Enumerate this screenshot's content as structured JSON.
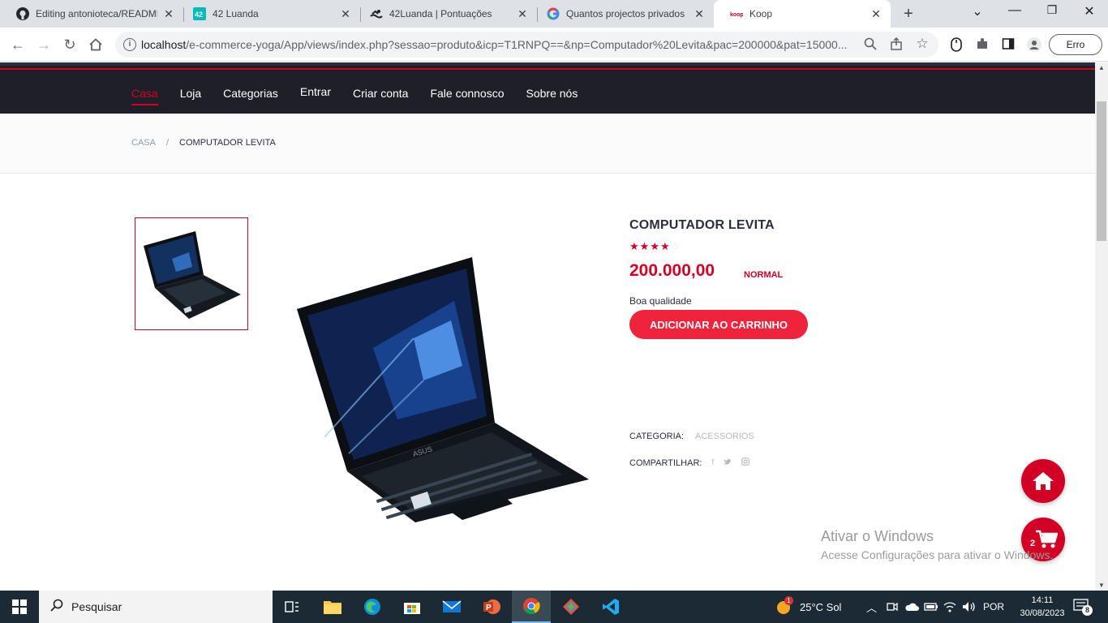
{
  "browser": {
    "tabs": [
      {
        "title": "Editing antonioteca/README.",
        "icon": "github-icon"
      },
      {
        "title": "42 Luanda",
        "icon": "42-icon"
      },
      {
        "title": "42Luanda | Pontuações",
        "icon": "swimmer-icon"
      },
      {
        "title": "Quantos projectos privados",
        "icon": "google-icon"
      },
      {
        "title": "Koop",
        "icon": "koop-icon",
        "active": true
      }
    ],
    "url_host": "localhost",
    "url_path": "/e-commerce-yoga/App/views/index.php?sessao=produto&icp=T1RNPQ==&np=Computador%20Levita&pac=200000&pat=15000...",
    "profile_button": "Erro",
    "newtab_glyph": "+",
    "close_glyph": "✕"
  },
  "site": {
    "nav": [
      "Casa",
      "Loja",
      "Categorias",
      "Entrar",
      "Criar conta",
      "Fale connosco",
      "Sobre nós"
    ],
    "breadcrumb": {
      "home": "CASA",
      "separator": "/",
      "current": "COMPUTADOR LEVITA"
    },
    "product": {
      "name": "COMPUTADOR LEVITA",
      "rating": 4,
      "rating_max": 5,
      "price": "200.000,00",
      "tag": "NORMAL",
      "description": "Boa qualidade",
      "add_to_cart": "ADICIONAR AO CARRINHO",
      "category_label": "CATEGORIA:",
      "category_value": "ACESSORIOS",
      "share_label": "COMPARTILHAR:"
    },
    "cart_count": "2"
  },
  "watermark": {
    "line1": "Ativar o Windows",
    "line2": "Acesse Configurações para ativar o Windows."
  },
  "taskbar": {
    "search_placeholder": "Pesquisar",
    "weather": "25°C  Sol",
    "weather_badge": "1",
    "language": "POR",
    "time": "14:11",
    "date": "30/08/2023",
    "notifications": "8"
  },
  "colors": {
    "accent": "#d10024",
    "nav_bg": "#1e1f29",
    "button": "#ef233c"
  }
}
